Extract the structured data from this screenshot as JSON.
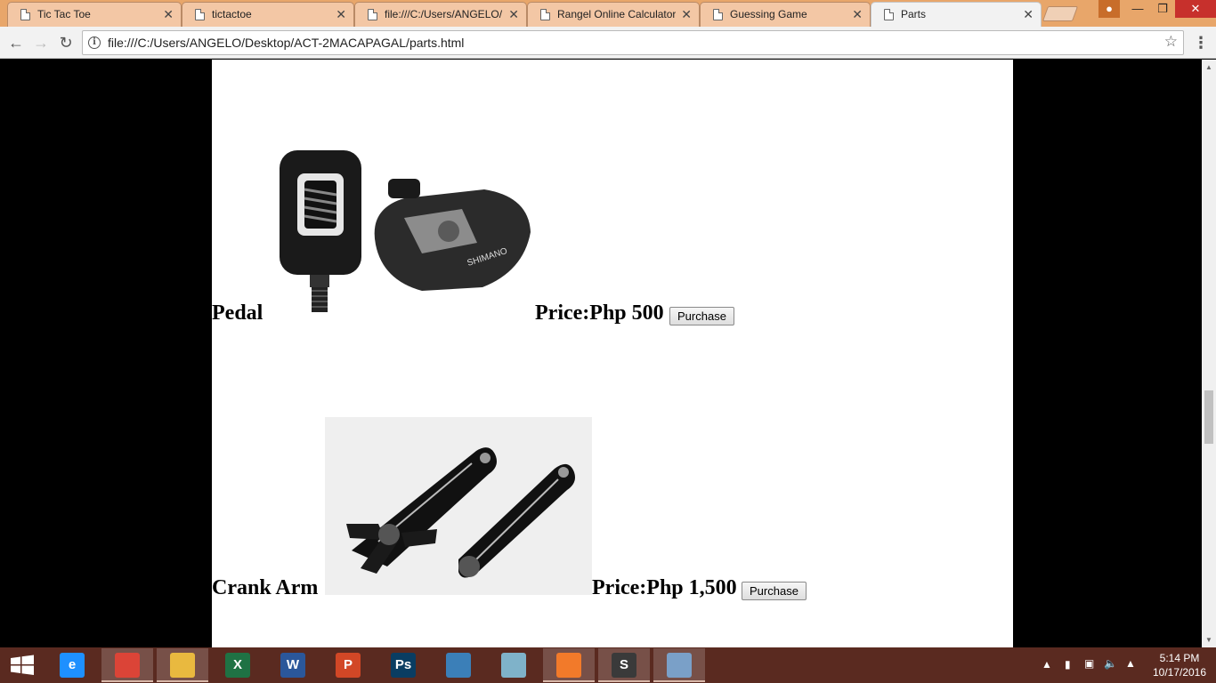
{
  "browser": {
    "tabs": [
      {
        "title": "Tic Tac Toe",
        "active": false
      },
      {
        "title": "tictactoe",
        "active": false
      },
      {
        "title": "file:///C:/Users/ANGELO/",
        "active": false
      },
      {
        "title": "Rangel Online Calculator",
        "active": false
      },
      {
        "title": "Guessing Game",
        "active": false
      },
      {
        "title": "Parts",
        "active": true
      }
    ],
    "url": "file:///C:/Users/ANGELO/Desktop/ACT-2MACAPAGAL/parts.html",
    "close_glyph": "✕"
  },
  "page": {
    "items": [
      {
        "name": "Pedal",
        "price": "Price:Php 500",
        "button": "Purchase"
      },
      {
        "name": "Crank Arm",
        "price": "Price:Php 1,500",
        "button": "Purchase"
      }
    ]
  },
  "taskbar": {
    "apps": [
      {
        "name": "internet-explorer-icon",
        "label": "e",
        "color": "#1e90ff",
        "running": false
      },
      {
        "name": "chrome-icon",
        "label": "",
        "color": "#db4437",
        "running": true
      },
      {
        "name": "file-explorer-icon",
        "label": "",
        "color": "#e9b93f",
        "running": true
      },
      {
        "name": "excel-icon",
        "label": "X",
        "color": "#1f7244",
        "running": false
      },
      {
        "name": "word-icon",
        "label": "W",
        "color": "#2b579a",
        "running": false
      },
      {
        "name": "powerpoint-icon",
        "label": "P",
        "color": "#d24726",
        "running": false
      },
      {
        "name": "photoshop-icon",
        "label": "Ps",
        "color": "#0a3d62",
        "running": false
      },
      {
        "name": "mysql-installer-icon",
        "label": "",
        "color": "#3b7fb8",
        "running": false
      },
      {
        "name": "notepad-icon",
        "label": "",
        "color": "#7fb2c9",
        "running": false
      },
      {
        "name": "xampp-icon",
        "label": "",
        "color": "#f27a2a",
        "running": true
      },
      {
        "name": "sublime-text-icon",
        "label": "S",
        "color": "#3a3a3a",
        "running": true
      },
      {
        "name": "paint-icon",
        "label": "",
        "color": "#7aa0c8",
        "running": true
      }
    ],
    "time": "5:14 PM",
    "date": "10/17/2016"
  }
}
